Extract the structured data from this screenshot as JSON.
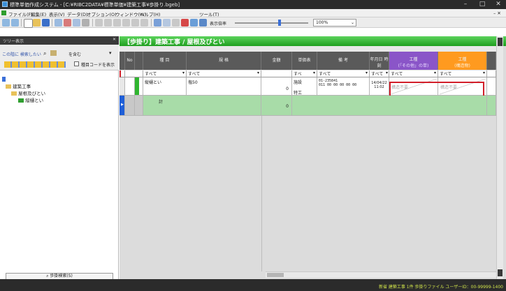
{
  "window": {
    "title": "標準単価作成システム - [C:¥RIBC2DATA¥標準単価¥建築工事¥歩掛り.bgeb]",
    "minimize": "–",
    "maximize": "□",
    "close": "✕"
  },
  "menu": [
    "ファイル(F)",
    "編集(E)",
    "表示(V)",
    "データ(D)",
    "オプション(O)",
    "ウィンドウ(W)",
    "ヘルプ(H)",
    "ツール(T)"
  ],
  "toolbar": {
    "display_ratio_label": "表示倍率",
    "zoom_value": "100%"
  },
  "tree_panel": {
    "header": "ツリー表示",
    "search_label": "この階に 検索したい",
    "search_scope": "を含む",
    "checkbox_label": "種目コードを表示",
    "items": [
      "建築工事",
      "屋根及びとい",
      "縦樋とい"
    ],
    "bottom_button": "歩掛検索(S)"
  },
  "banner": "【歩掛り】建築工事 / 屋根及びとい",
  "columns": {
    "no": "No",
    "item": "種 目",
    "spec": "規 格",
    "amount": "金額",
    "unit_price": "単価表",
    "remarks": "備 考",
    "date": "年月日 時刻",
    "work_a": "工種",
    "work_a_sub": "(「その他」の単)",
    "work_b": "工種",
    "work_b_sub": "(構造物)"
  },
  "filters": {
    "all": "すべて",
    "all_short": "すべ"
  },
  "rows": [
    {
      "item": "縦樋とい",
      "spec": "塩50",
      "amount": "0",
      "unit_price_top": "施設",
      "unit_price_bottom": "特工",
      "remarks_top": "01-235841",
      "remarks_bottom": "011 00  00  00  00  00",
      "date": "14/04/22 11:02",
      "work_a": "構造不要",
      "work_b": "構造不要"
    },
    {
      "item": "計",
      "amount": "0"
    }
  ],
  "status": {
    "text": "新省 建築工事 1件 歩掛りファイル ユーザーID：00-99999-1400"
  },
  "colors": {
    "banner_green": "#2fb52f",
    "header_purple": "#8a55c8",
    "header_orange": "#ff9a1f",
    "highlight_red": "#d21f2a"
  }
}
